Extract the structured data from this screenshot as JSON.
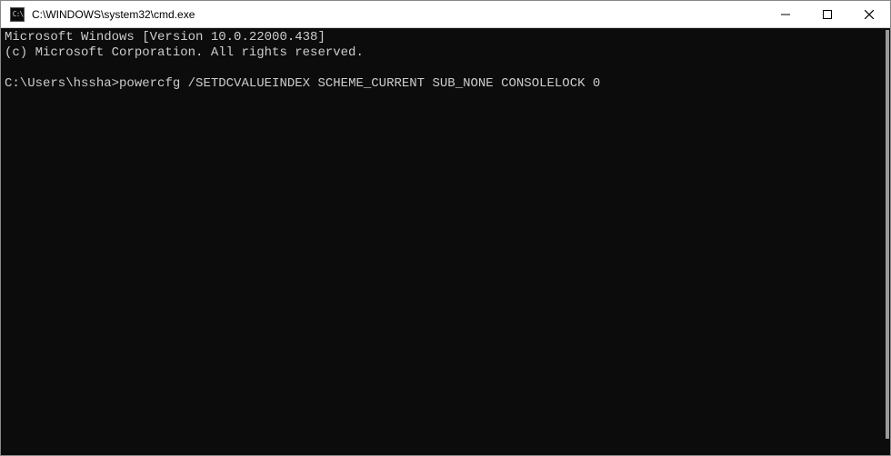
{
  "titlebar": {
    "icon_label": "cmd-icon",
    "title": "C:\\WINDOWS\\system32\\cmd.exe"
  },
  "console": {
    "line1": "Microsoft Windows [Version 10.0.22000.438]",
    "line2": "(c) Microsoft Corporation. All rights reserved.",
    "blank": "",
    "prompt": "C:\\Users\\hssha>",
    "command": "powercfg /SETDCVALUEINDEX SCHEME_CURRENT SUB_NONE CONSOLELOCK 0"
  }
}
